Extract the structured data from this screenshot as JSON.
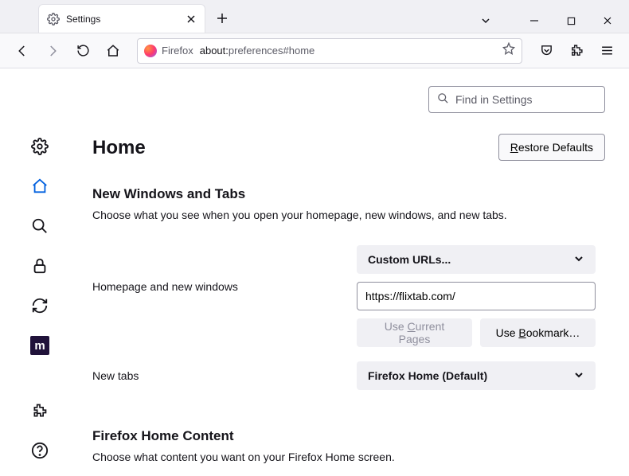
{
  "window": {
    "tab_label": "Settings"
  },
  "urlbar": {
    "identity": "Firefox",
    "path_prefix": "about:",
    "path_rest": "preferences#home"
  },
  "search": {
    "placeholder": "Find in Settings"
  },
  "page": {
    "title": "Home",
    "restore_btn": "Restore Defaults"
  },
  "section1": {
    "heading": "New Windows and Tabs",
    "desc": "Choose what you see when you open your homepage, new windows, and new tabs."
  },
  "homepage": {
    "label": "Homepage and new windows",
    "dropdown_value": "Custom URLs...",
    "url_value": "https://flixtab.com/",
    "use_current": "Use Current Pages",
    "use_bookmark": "Use Bookmark…"
  },
  "newtabs": {
    "label": "New tabs",
    "dropdown_value": "Firefox Home (Default)"
  },
  "section2": {
    "heading": "Firefox Home Content",
    "desc": "Choose what content you want on your Firefox Home screen."
  },
  "monogram": "m"
}
